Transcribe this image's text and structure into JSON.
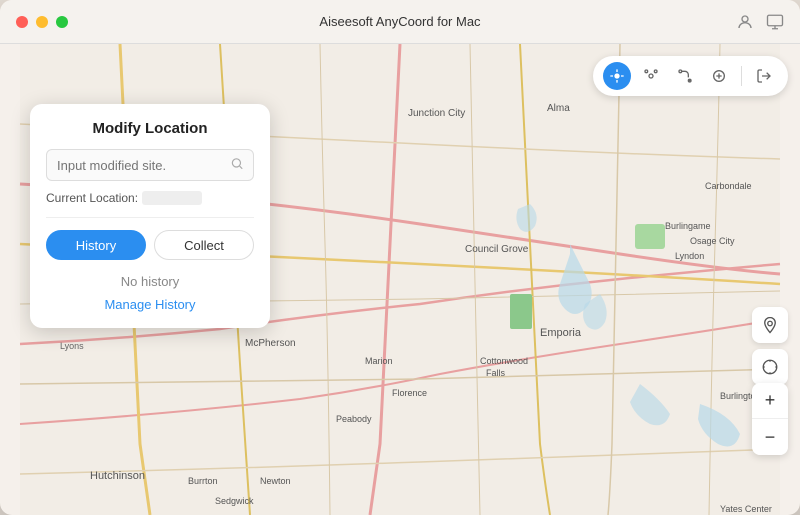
{
  "window": {
    "title": "Aiseesoft AnyCoord for Mac"
  },
  "titlebar": {
    "title": "Aiseesoft AnyCoord for Mac",
    "user_icon": "person-icon",
    "monitor_icon": "monitor-icon"
  },
  "modify_panel": {
    "title": "Modify Location",
    "search_placeholder": "Input modified site.",
    "current_location_label": "Current Location:",
    "tab_history": "History",
    "tab_collect": "Collect",
    "no_history_text": "No history",
    "manage_history_text": "Manage History"
  },
  "map_toolbar": {
    "btn_locate": "locate-icon",
    "btn_dot": "dot-icon",
    "btn_route": "route-icon",
    "btn_joystick": "joystick-icon",
    "btn_export": "export-icon"
  },
  "map_zoom": {
    "plus_label": "+",
    "minus_label": "−"
  }
}
